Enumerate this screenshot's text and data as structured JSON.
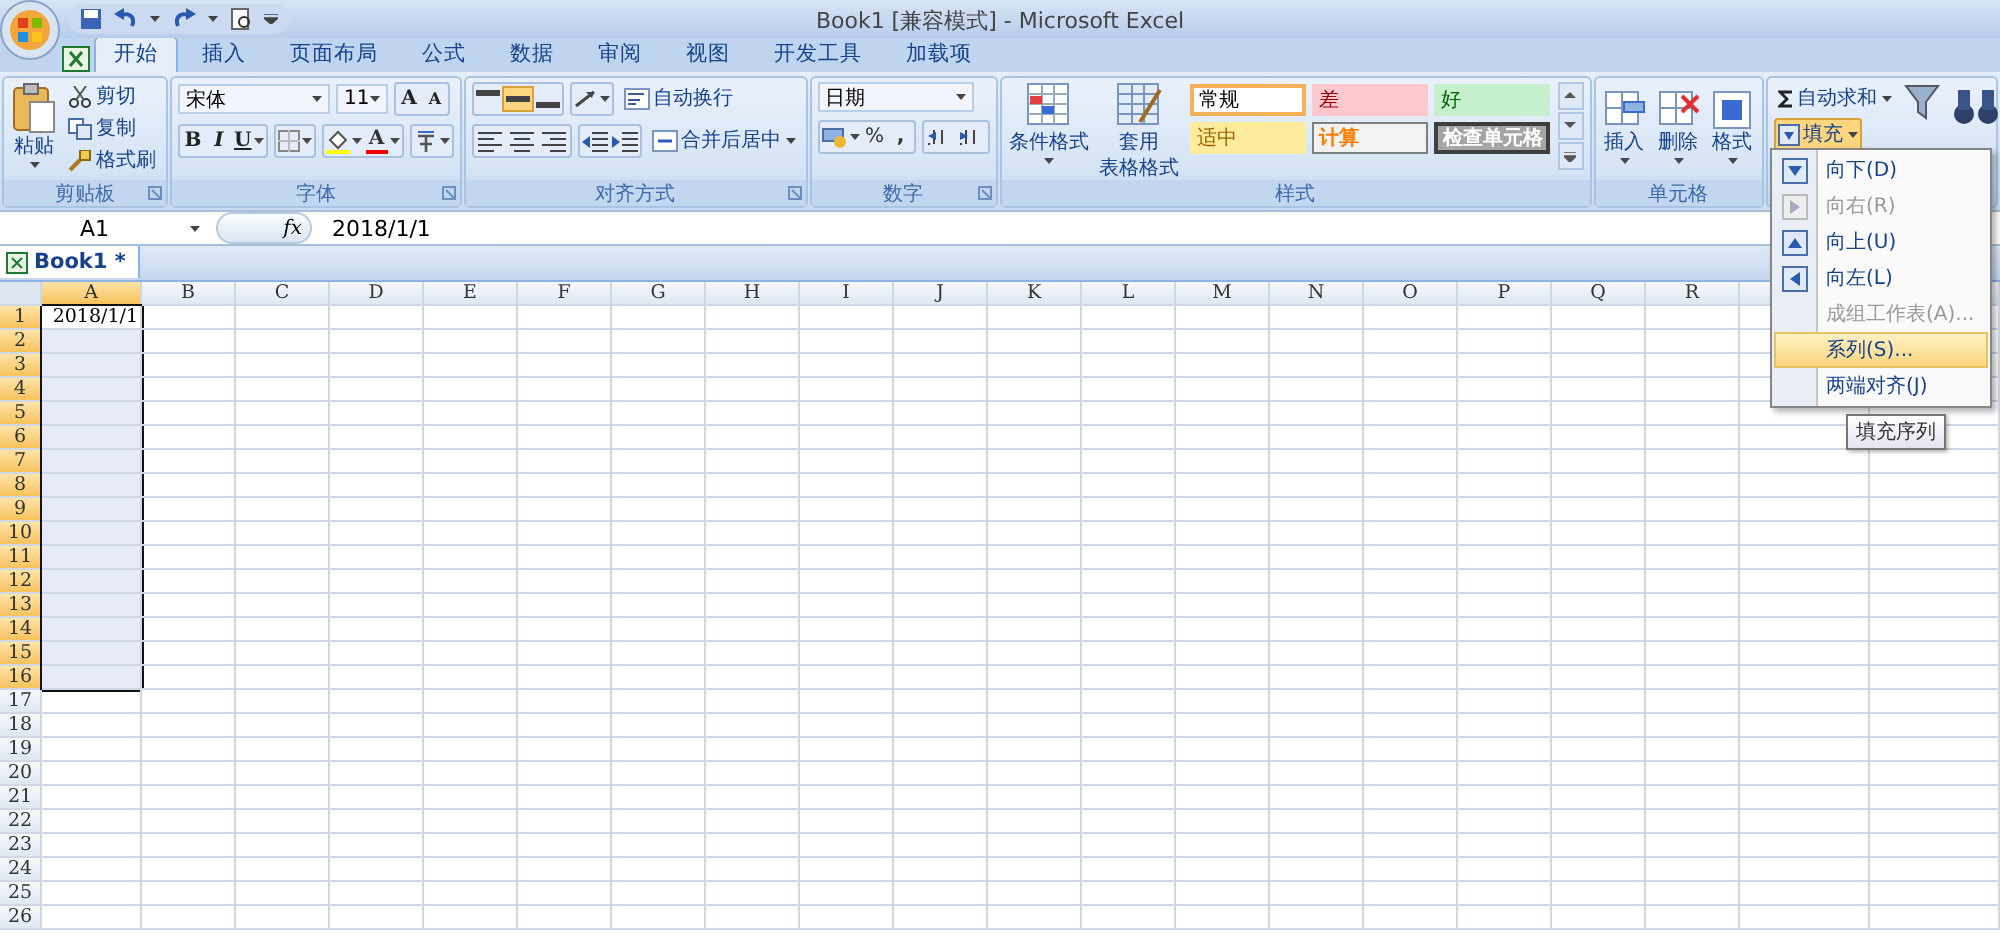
{
  "window": {
    "title": "Book1  [兼容模式] - Microsoft Excel"
  },
  "tabs": [
    {
      "label": "开始",
      "selected": true
    },
    {
      "label": "插入",
      "selected": false
    },
    {
      "label": "页面布局",
      "selected": false
    },
    {
      "label": "公式",
      "selected": false
    },
    {
      "label": "数据",
      "selected": false
    },
    {
      "label": "审阅",
      "selected": false
    },
    {
      "label": "视图",
      "selected": false
    },
    {
      "label": "开发工具",
      "selected": false
    },
    {
      "label": "加载项",
      "selected": false
    }
  ],
  "clipboard": {
    "label": "剪贴板",
    "paste": "粘贴",
    "cut": "剪切",
    "copy": "复制",
    "format_painter": "格式刷"
  },
  "font": {
    "label": "字体",
    "name": "宋体",
    "size": "11",
    "grow": "A",
    "shrink": "A",
    "bold": "B",
    "italic": "I",
    "underline": "U",
    "font_color_label": "A"
  },
  "alignment": {
    "label": "对齐方式",
    "vertical": [
      {
        "selected": false
      },
      {
        "selected": true
      },
      {
        "selected": false
      }
    ],
    "wrap": "自动换行",
    "merge": "合并后居中"
  },
  "number": {
    "label": "数字",
    "format": "日期",
    "percent": "%",
    "comma": ","
  },
  "styles": {
    "label": "样式",
    "conditional": "条件格式",
    "table_format": "套用",
    "table_format_2": "表格格式",
    "cells": [
      {
        "label": "常规",
        "kind": "normal",
        "selected": true
      },
      {
        "label": "差",
        "kind": "bad",
        "selected": false
      },
      {
        "label": "好",
        "kind": "good",
        "selected": false
      },
      {
        "label": "适中",
        "kind": "neutral",
        "selected": false
      },
      {
        "label": "计算",
        "kind": "calculation",
        "selected": false
      },
      {
        "label": "检查单元格",
        "kind": "check",
        "selected": false
      }
    ]
  },
  "cells_group": {
    "label": "单元格",
    "buttons": [
      {
        "label": "插入",
        "kind": "insert"
      },
      {
        "label": "删除",
        "kind": "delete"
      },
      {
        "label": "格式",
        "kind": "format"
      }
    ]
  },
  "editing": {
    "autosum": "自动求和",
    "fill": "填充"
  },
  "formula_bar": {
    "name_box": "A1",
    "fx": "fx",
    "value": "2018/1/1"
  },
  "workbook_tab": "Book1 *",
  "grid": {
    "columns": [
      {
        "label": "A",
        "selected": true
      },
      {
        "label": "B",
        "selected": false
      },
      {
        "label": "C",
        "selected": false
      },
      {
        "label": "D",
        "selected": false
      },
      {
        "label": "E",
        "selected": false
      },
      {
        "label": "F",
        "selected": false
      },
      {
        "label": "G",
        "selected": false
      },
      {
        "label": "H",
        "selected": false
      },
      {
        "label": "I",
        "selected": false
      },
      {
        "label": "J",
        "selected": false
      },
      {
        "label": "K",
        "selected": false
      },
      {
        "label": "L",
        "selected": false
      },
      {
        "label": "M",
        "selected": false
      },
      {
        "label": "N",
        "selected": false
      },
      {
        "label": "O",
        "selected": false
      },
      {
        "label": "P",
        "selected": false
      },
      {
        "label": "Q",
        "selected": false
      },
      {
        "label": "R",
        "selected": false
      }
    ],
    "rows": [
      {
        "label": "1",
        "selected": true,
        "cells": [
          "2018/1/1"
        ]
      },
      {
        "label": "2",
        "selected": true
      },
      {
        "label": "3",
        "selected": true
      },
      {
        "label": "4",
        "selected": true
      },
      {
        "label": "5",
        "selected": true
      },
      {
        "label": "6",
        "selected": true
      },
      {
        "label": "7",
        "selected": true
      },
      {
        "label": "8",
        "selected": true
      },
      {
        "label": "9",
        "selected": true
      },
      {
        "label": "10",
        "selected": true
      },
      {
        "label": "11",
        "selected": true
      },
      {
        "label": "12",
        "selected": true
      },
      {
        "label": "13",
        "selected": true
      },
      {
        "label": "14",
        "selected": true
      },
      {
        "label": "15",
        "selected": true
      },
      {
        "label": "16",
        "selected": true
      },
      {
        "label": "17",
        "selected": false
      },
      {
        "label": "18",
        "selected": false
      },
      {
        "label": "19",
        "selected": false
      },
      {
        "label": "20",
        "selected": false
      },
      {
        "label": "21",
        "selected": false
      },
      {
        "label": "22",
        "selected": false
      },
      {
        "label": "23",
        "selected": false
      },
      {
        "label": "24",
        "selected": false
      },
      {
        "label": "25",
        "selected": false
      },
      {
        "label": "26",
        "selected": false
      }
    ]
  },
  "fill_menu": {
    "items": [
      {
        "label": "向下(D)",
        "kind": "down",
        "disabled": false,
        "selected": false
      },
      {
        "label": "向右(R)",
        "kind": "right",
        "disabled": true,
        "selected": false
      },
      {
        "label": "向上(U)",
        "kind": "up",
        "disabled": false,
        "selected": false
      },
      {
        "label": "向左(L)",
        "kind": "left",
        "disabled": false,
        "selected": false
      },
      {
        "label": "成组工作表(A)...",
        "kind": "none",
        "disabled": true,
        "selected": false
      },
      {
        "label": "系列(S)...",
        "kind": "none",
        "disabled": false,
        "selected": true
      },
      {
        "label": "两端对齐(J)",
        "kind": "none",
        "disabled": false,
        "selected": false
      }
    ],
    "tooltip": "填充序列"
  }
}
